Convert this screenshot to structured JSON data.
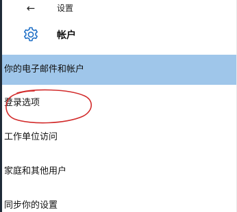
{
  "titlebar": {
    "back_icon": "back-arrow-icon",
    "back_glyph": "←",
    "title": "设置"
  },
  "header": {
    "icon": "gear-icon",
    "title": "帐户"
  },
  "nav": {
    "items": [
      {
        "label": "你的电子邮件和帐户",
        "selected": true
      },
      {
        "label": "登录选项",
        "selected": false
      },
      {
        "label": "工作单位访问",
        "selected": false
      },
      {
        "label": "家庭和其他用户",
        "selected": false
      },
      {
        "label": "同步你的设置",
        "selected": false
      }
    ]
  },
  "colors": {
    "selected_background": "#9fc6ea",
    "accent": "#1e6fc6",
    "annotation": "#d22a2a",
    "left_edge": "#1f2b38"
  }
}
